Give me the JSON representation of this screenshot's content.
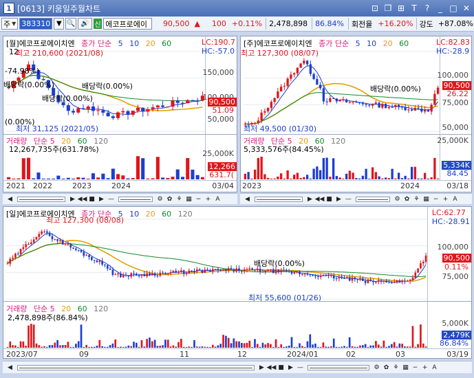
{
  "window": {
    "code_label": "1",
    "title": "[0613] 키움일주월차트"
  },
  "toolbar": {
    "market": "주",
    "stock_code": "383310",
    "new_badge": "신",
    "stock_name": "에코프로에이",
    "price": "90,500",
    "change": "100",
    "change_pct": "+0.11%",
    "volume": "2,478,898",
    "volume_ratio": "86.84%",
    "turnover_label": "회전율",
    "turnover": "+16.20%",
    "strength_label": "강도",
    "strength": "+87.08%"
  },
  "colors": {
    "up": "#e0161b",
    "down": "#1b3fd0",
    "ma5": "#1a3ec9",
    "ma20": "#e4a100",
    "ma60": "#0f8a2a",
    "ma120": "#777777"
  },
  "panels": {
    "monthly": {
      "legend": {
        "name": "[월]에코프로에이치엔",
        "ma": "종가 단순",
        "p5": "5",
        "p10": "10",
        "p20": "20",
        "p60": "60"
      },
      "lc": "LC:190.7",
      "hc": "HC:-57.0",
      "yticks": [
        "150,000",
        "100,000",
        "50,000"
      ],
      "price_tag": "90,500",
      "pct": "51.09",
      "high": "최고 210,600 (2021/08)",
      "low": "최저 31,125 (2021/05)",
      "left_top": "12",
      "pct_neg": "-74.98%)",
      "div1": "배당락(0.00%)",
      "div2": "배당락(0.00%)",
      "div3": "배당락(0.00%)",
      "low_pct": "(0.00%)",
      "vol_legend": {
        "name": "거래량",
        "ma": "단순 5",
        "p20": "20",
        "p60": "60",
        "p120": "120"
      },
      "vol_value": "12,267,735주(631.78%)",
      "vol_ytick": "25,000K",
      "vol_tag": "12,266",
      "vol_pct": "631.7(",
      "xticks": [
        "2021",
        "2022",
        "2023",
        "2024"
      ],
      "xdate": "03/04"
    },
    "weekly": {
      "legend": {
        "name": "[주]에코프로에이치엔",
        "ma": "종가 단순",
        "p5": "5",
        "p10": "10",
        "p20": "20",
        "p60": "60"
      },
      "lc": "LC:82.83",
      "hc": "HC:-28.9",
      "yticks": [
        "100,000",
        "75,000",
        "50,000"
      ],
      "price_tag": "90,500",
      "pct": "26.22",
      "high": "최고 127,300 (08/07)",
      "low": "최저 49,500 (01/30)",
      "div1": "배당락(0.00%)",
      "vol_legend": {
        "name": "거래량",
        "ma": "단순 5",
        "p20": "20",
        "p60": "60",
        "p120": "120"
      },
      "vol_value": "5,333,576주(84.45%)",
      "vol_ytick": "25,000K",
      "vol_tag": "5,334K",
      "vol_pct": "84.45",
      "xticks": [
        "2023",
        "2024"
      ],
      "xdate": "03/18"
    },
    "daily": {
      "legend": {
        "name": "[일]에코프로에이치엔",
        "ma": "종가 단순",
        "p5": "5",
        "p10": "10",
        "p20": "20",
        "p60": "60",
        "p120": "120"
      },
      "lc": "LC:62.77",
      "hc": "HC:-28.91",
      "yticks": [
        "100,000",
        "75,000"
      ],
      "price_tag": "90,500",
      "pct": "0.11%",
      "high": "최고 127,300 (08/08)",
      "low": "최저 55,600 (01/26)",
      "div1": "배당락(0.00%)",
      "vol_legend": {
        "name": "거래량",
        "ma": "단순 5",
        "p20": "20",
        "p60": "60",
        "p120": "120"
      },
      "vol_value": "2,478,898주(86.84%)",
      "vol_ytick": "5,000K",
      "vol_tag": "2,479K",
      "vol_pct": "86.84%",
      "xticks": [
        "2023/07",
        "09",
        "11",
        "12",
        "2024/01",
        "02",
        "03"
      ],
      "xdate": "03/19"
    }
  }
}
